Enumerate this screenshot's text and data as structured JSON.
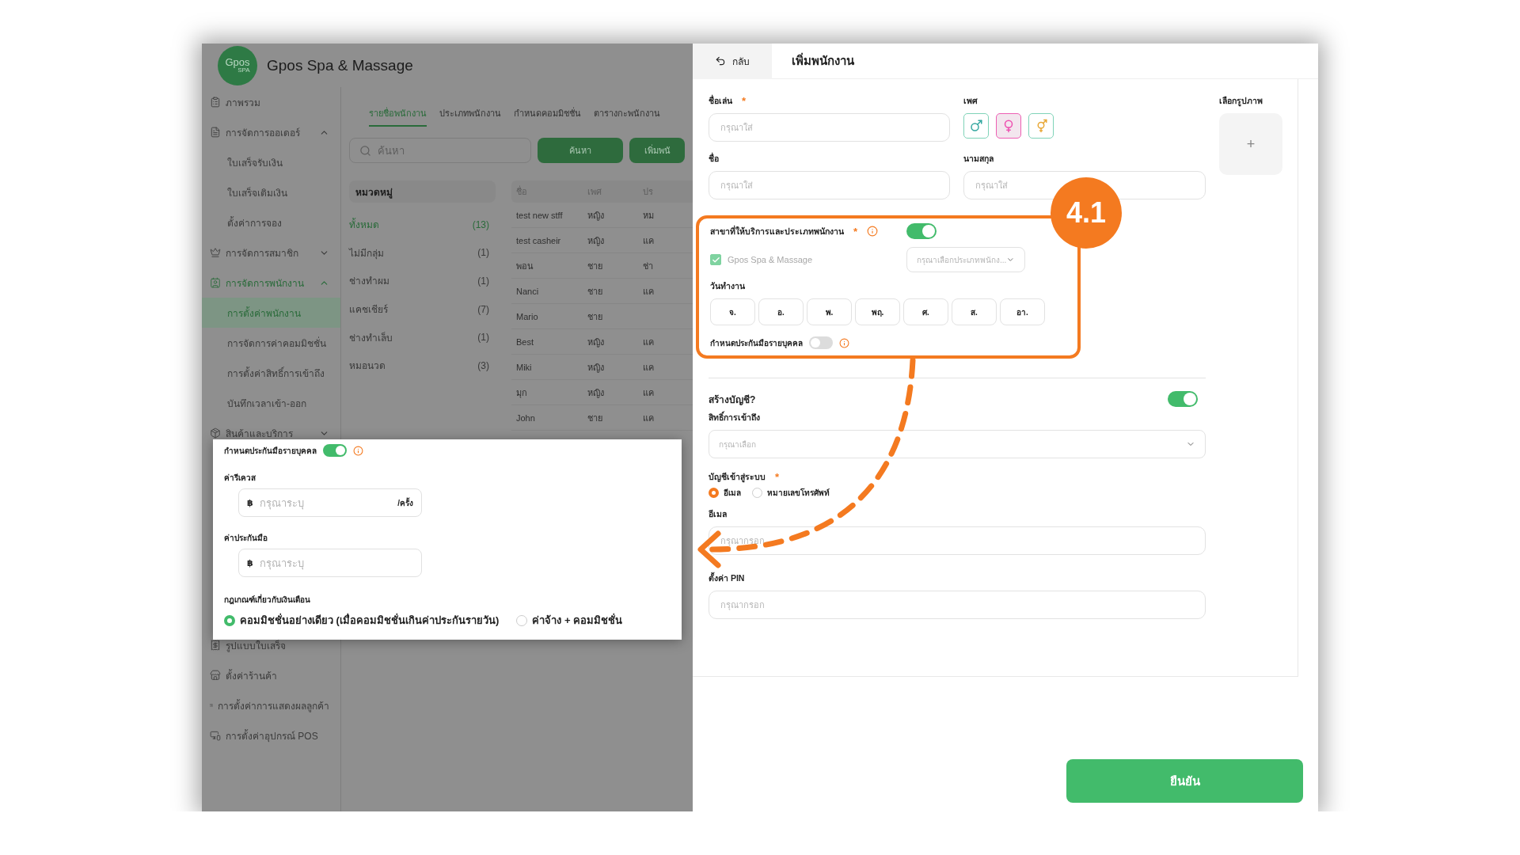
{
  "app": {
    "logo": {
      "text": "Gpos",
      "subtext": "SPA"
    },
    "title": "Gpos Spa & Massage"
  },
  "sidebar": {
    "items": [
      {
        "label": "ภาพรวม",
        "kind": "item",
        "selected": false
      },
      {
        "label": "การจัดการออเดอร์",
        "kind": "group",
        "selected": false,
        "expanded": true
      },
      {
        "label": "ใบเสร็จรับเงิน",
        "kind": "sub",
        "selected": false
      },
      {
        "label": "ใบเสร็จเติมเงิน",
        "kind": "sub",
        "selected": false
      },
      {
        "label": "ตั้งค่าการจอง",
        "kind": "sub",
        "selected": false
      },
      {
        "label": "การจัดการสมาชิก",
        "kind": "group",
        "selected": false,
        "expanded": false
      },
      {
        "label": "การจัดการพนักงาน",
        "kind": "group",
        "selected": true,
        "expanded": true
      },
      {
        "label": "การตั้งค่าพนักงาน",
        "kind": "sub",
        "selected": true
      },
      {
        "label": "การจัดการค่าคอมมิชชั่น",
        "kind": "sub",
        "selected": false
      },
      {
        "label": "การตั้งค่าสิทธิ์การเข้าถึง",
        "kind": "sub",
        "selected": false
      },
      {
        "label": "บันทึกเวลาเข้า-ออก",
        "kind": "sub",
        "selected": false
      },
      {
        "label": "สินค้าและบริการ",
        "kind": "group",
        "selected": false,
        "expanded": false
      }
    ],
    "lower_items": [
      {
        "label": "รูปแบบใบเสร็จ",
        "kind": "item",
        "selected": false
      },
      {
        "label": "ตั้งค่าร้านค้า",
        "kind": "item",
        "selected": false
      },
      {
        "label": "การตั้งค่าการแสดงผลลูกค้า",
        "kind": "item",
        "selected": false
      },
      {
        "label": "การตั้งค่าอุปกรณ์ POS",
        "kind": "item",
        "selected": false
      }
    ]
  },
  "tabs": [
    {
      "label": "รายชื่อพนักงาน",
      "selected": true
    },
    {
      "label": "ประเภทพนักงาน",
      "selected": false
    },
    {
      "label": "กำหนดคอมมิชชั่น",
      "selected": false
    },
    {
      "label": "ตารางกะพนักงาน",
      "selected": false
    }
  ],
  "search": {
    "placeholder": "ค้นหา",
    "buttons": [
      "ค้นหา",
      "เพิ่มพนั"
    ]
  },
  "categories": {
    "title": "หมวดหมู่",
    "items": [
      {
        "label": "ทั้งหมด",
        "count": "(13)",
        "selected": true
      },
      {
        "label": "ไม่มีกลุ่ม",
        "count": "(1)",
        "selected": false
      },
      {
        "label": "ช่างทำผม",
        "count": "(1)",
        "selected": false
      },
      {
        "label": "แคชเชียร์",
        "count": "(7)",
        "selected": false
      },
      {
        "label": "ช่างทำเล็บ",
        "count": "(1)",
        "selected": false
      },
      {
        "label": "หมอนวด",
        "count": "(3)",
        "selected": false
      }
    ]
  },
  "table": {
    "columns": [
      "ชื่อ",
      "เพศ",
      "ปร"
    ],
    "rows": [
      [
        "test new stff",
        "หญิง",
        "หม"
      ],
      [
        "test casheir",
        "หญิง",
        "แค"
      ],
      [
        "พอน",
        "ชาย",
        "ช่า"
      ],
      [
        "Nanci",
        "ชาย",
        "แค"
      ],
      [
        "Mario",
        "ชาย"
      ],
      [
        "Best",
        "หญิง",
        "แค"
      ],
      [
        "Miki",
        "หญิง",
        "แค"
      ],
      [
        "มุก",
        "หญิง",
        "แค"
      ],
      [
        "John",
        "ชาย",
        "แค"
      ]
    ]
  },
  "popup": {
    "toggle": {
      "label": "กำหนดประกันมือรายบุคคล",
      "on": true
    },
    "fields": [
      {
        "label": "ค่ารีเควส",
        "prefix": "฿",
        "placeholder": "กรุณาระบุ",
        "suffix": "/ครั้ง"
      },
      {
        "label": "ค่าประกันมือ",
        "prefix": "฿",
        "placeholder": "กรุณาระบุ"
      }
    ],
    "rule": {
      "label": "กฎเกณฑ์เกี่ยวกับเงินเดือน",
      "options": [
        {
          "label": "คอมมิชชั่นอย่างเดียว (เมื่อคอมมิชชั่นเกินค่าประกันรายวัน)",
          "selected": true
        },
        {
          "label": "ค่าจ้าง + คอมมิชชั่น",
          "selected": false
        }
      ]
    }
  },
  "drawer": {
    "back": "กลับ",
    "title": "เพิ่มพนักงาน",
    "nickname": {
      "label": "ชื่อเล่น",
      "mark": "*",
      "placeholder": "กรุณาใส่"
    },
    "gender": {
      "label": "เพศ",
      "options": [
        {
          "kind": "male",
          "selected": false
        },
        {
          "kind": "female",
          "selected": true
        },
        {
          "kind": "both",
          "selected": false
        }
      ]
    },
    "image": {
      "label": "เลือกรูปภาพ",
      "button": "+"
    },
    "first_name": {
      "label": "ชื่อ",
      "placeholder": "กรุณาใส่"
    },
    "last_name": {
      "label": "นามสกุล",
      "placeholder": "กรุณาใส่"
    },
    "branch": {
      "label": "สาขาที่ให้บริการและประเภทพนักงาน",
      "mark": "*",
      "on": true,
      "branches": [
        {
          "label": "Gpos Spa & Massage",
          "checked": true,
          "type_placeholder": "กรุณาเลือกประเภทพนักง..."
        }
      ]
    },
    "workdays": {
      "label": "วันทำงาน",
      "days": [
        {
          "label": "จ.",
          "selected": false
        },
        {
          "label": "อ.",
          "selected": false
        },
        {
          "label": "พ.",
          "selected": false
        },
        {
          "label": "พฤ.",
          "selected": false
        },
        {
          "label": "ศ.",
          "selected": false
        },
        {
          "label": "ส.",
          "selected": false
        },
        {
          "label": "อา.",
          "selected": false
        }
      ]
    },
    "guarantee": {
      "label": "กำหนดประกันมือรายบุคคล",
      "on": false
    },
    "account": {
      "label": "สร้างบัญชี?",
      "on": true
    },
    "access": {
      "label": "สิทธิ์การเข้าถึง",
      "placeholder": "กรุณาเลือก"
    },
    "login": {
      "label": "บัญชีเข้าสู่ระบบ",
      "mark": "*",
      "options": [
        {
          "label": "อีเมล",
          "selected": true
        },
        {
          "label": "หมายเลขโทรศัพท์",
          "selected": false
        }
      ]
    },
    "email": {
      "label": "อีเมล",
      "placeholder": "กรุณากรอก"
    },
    "pin": {
      "label": "ตั้งค่า PIN",
      "placeholder": "กรุณากรอก"
    },
    "confirm": "ยืนยัน"
  },
  "annotation": {
    "badge": "4.1"
  }
}
